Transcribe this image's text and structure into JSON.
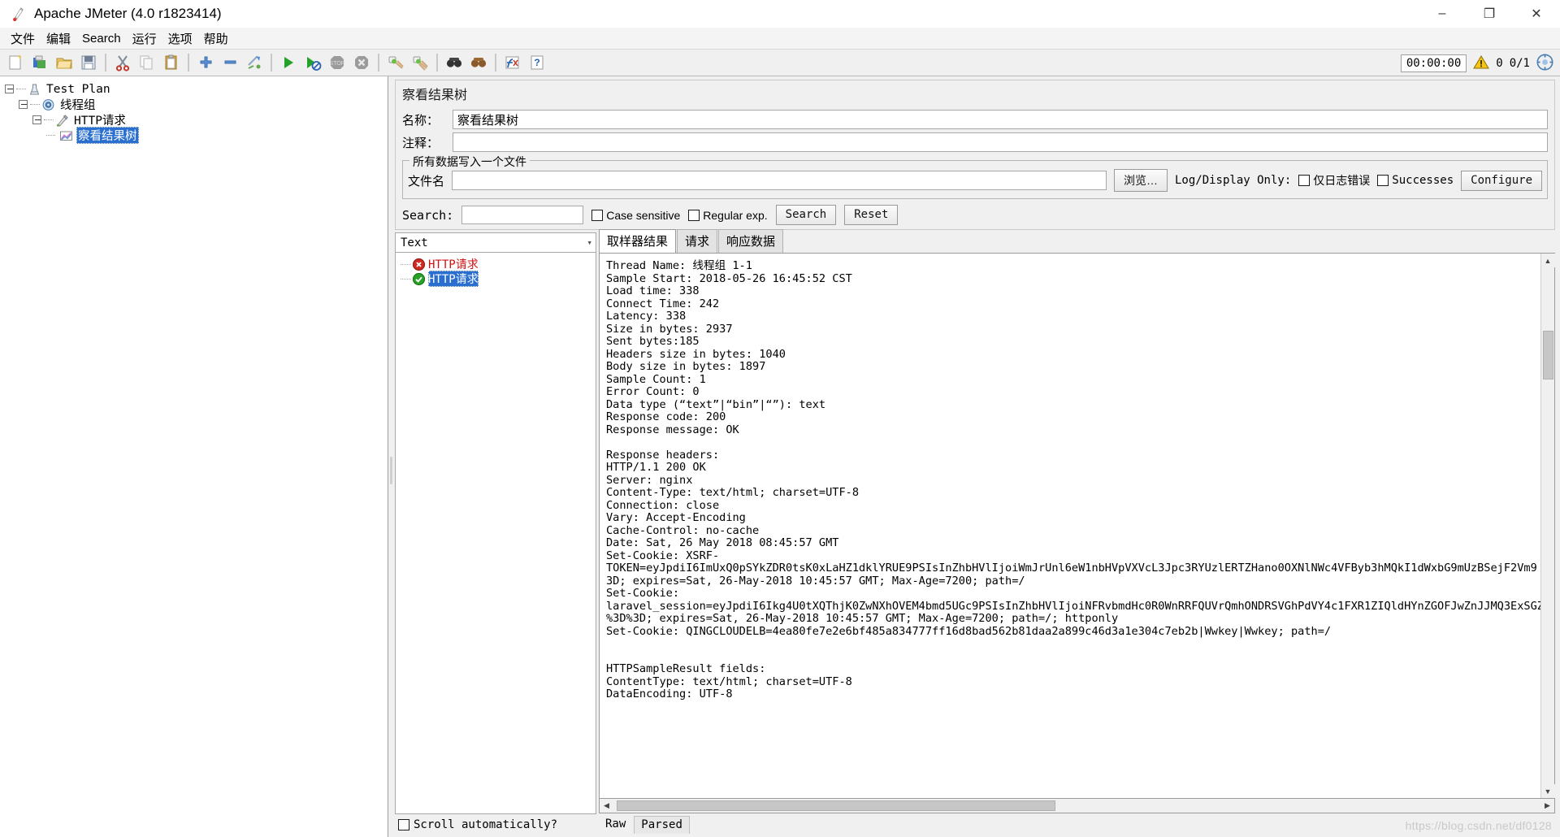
{
  "window": {
    "title": "Apache JMeter (4.0 r1823414)",
    "app_icon": "jmeter-feather-icon",
    "minimize": "–",
    "maximize": "❐",
    "close": "✕"
  },
  "menu": {
    "items": [
      {
        "name": "menu-file",
        "label": "文件"
      },
      {
        "name": "menu-edit",
        "label": "编辑"
      },
      {
        "name": "menu-search",
        "label": "Search"
      },
      {
        "name": "menu-run",
        "label": "运行"
      },
      {
        "name": "menu-options",
        "label": "选项"
      },
      {
        "name": "menu-help",
        "label": "帮助"
      }
    ]
  },
  "toolbar": {
    "buttons": [
      {
        "name": "new-button",
        "icon": "new-document-icon"
      },
      {
        "name": "templates-button",
        "icon": "templates-icon"
      },
      {
        "name": "open-button",
        "icon": "open-folder-icon"
      },
      {
        "name": "save-button",
        "icon": "save-floppy-icon"
      },
      {
        "name": "cut-button",
        "icon": "cut-scissors-icon"
      },
      {
        "name": "copy-button",
        "icon": "copy-icon"
      },
      {
        "name": "paste-button",
        "icon": "paste-clipboard-icon"
      },
      {
        "name": "expand-button",
        "icon": "plus-icon"
      },
      {
        "name": "collapse-button",
        "icon": "minus-icon"
      },
      {
        "name": "toggle-button",
        "icon": "toggle-icon"
      },
      {
        "name": "start-button",
        "icon": "play-green-icon"
      },
      {
        "name": "start-no-pauses-button",
        "icon": "play-no-pause-icon"
      },
      {
        "name": "stop-button",
        "icon": "stop-sign-icon"
      },
      {
        "name": "shutdown-button",
        "icon": "shutdown-x-icon"
      },
      {
        "name": "clear-button",
        "icon": "clear-broom-icon"
      },
      {
        "name": "clear-all-button",
        "icon": "clear-all-broom-icon"
      },
      {
        "name": "search-button",
        "icon": "binoculars-icon"
      },
      {
        "name": "reset-search-button",
        "icon": "reset-search-icon"
      },
      {
        "name": "function-helper-button",
        "icon": "function-helper-icon"
      },
      {
        "name": "help-button",
        "icon": "question-help-icon"
      }
    ],
    "timer": "00:00:00",
    "warning_icon": "warning-triangle-icon",
    "warning_count": "0",
    "threads_count": "0/1",
    "status_icon": "active-threads-icon"
  },
  "tree": {
    "nodes": [
      {
        "name": "tree-node-test-plan",
        "label": "Test Plan",
        "icon": "test-plan-icon",
        "depth": 0,
        "expanded": true,
        "selected": false
      },
      {
        "name": "tree-node-thread-group",
        "label": "线程组",
        "icon": "thread-group-icon",
        "depth": 1,
        "expanded": true,
        "selected": false
      },
      {
        "name": "tree-node-http-request",
        "label": "HTTP请求",
        "icon": "http-request-icon",
        "depth": 2,
        "expanded": true,
        "selected": false
      },
      {
        "name": "tree-node-view-results-tree",
        "label": "察看结果树",
        "icon": "view-results-tree-icon",
        "depth": 3,
        "expanded": false,
        "selected": true
      }
    ]
  },
  "panel": {
    "title": "察看结果树",
    "name_label": "名称：",
    "name_value": "察看结果树",
    "comment_label": "注释：",
    "comment_value": "",
    "filegroup": {
      "legend": "所有数据写入一个文件",
      "filename_label": "文件名",
      "filename_value": "",
      "browse_label": "浏览…",
      "logdisplay_label": "Log/Display Only:",
      "errors_only_label": "仅日志错误",
      "errors_only_checked": false,
      "successes_label": "Successes",
      "successes_checked": false,
      "configure_label": "Configure"
    },
    "search": {
      "label": "Search:",
      "value": "",
      "case_sensitive_label": "Case sensitive",
      "case_sensitive_checked": false,
      "regex_label": "Regular exp.",
      "regex_checked": false,
      "search_button": "Search",
      "reset_button": "Reset"
    }
  },
  "results": {
    "render_selected": "Text",
    "items": [
      {
        "name": "result-item-failed",
        "label": "HTTP请求",
        "status": "error",
        "selected": false
      },
      {
        "name": "result-item-success",
        "label": "HTTP请求",
        "status": "ok",
        "selected": true
      }
    ],
    "scroll_auto_label": "Scroll automatically?",
    "scroll_auto_checked": false
  },
  "detail": {
    "tabs": [
      {
        "name": "tab-sampler-result",
        "label": "取样器结果",
        "active": true
      },
      {
        "name": "tab-request",
        "label": "请求",
        "active": false
      },
      {
        "name": "tab-response-data",
        "label": "响应数据",
        "active": false
      }
    ],
    "bottom_tabs": [
      {
        "name": "bottom-tab-raw",
        "label": "Raw",
        "active": false
      },
      {
        "name": "bottom-tab-parsed",
        "label": "Parsed",
        "active": true
      }
    ],
    "content": "Thread Name: 线程组 1-1\nSample Start: 2018-05-26 16:45:52 CST\nLoad time: 338\nConnect Time: 242\nLatency: 338\nSize in bytes: 2937\nSent bytes:185\nHeaders size in bytes: 1040\nBody size in bytes: 1897\nSample Count: 1\nError Count: 0\nData type (“text”|“bin”|“”): text\nResponse code: 200\nResponse message: OK\n\nResponse headers:\nHTTP/1.1 200 OK\nServer: nginx\nContent-Type: text/html; charset=UTF-8\nConnection: close\nVary: Accept-Encoding\nCache-Control: no-cache\nDate: Sat, 26 May 2018 08:45:57 GMT\nSet-Cookie: XSRF-\nTOKEN=eyJpdiI6ImUxQ0pSYkZDR0tsK0xLaHZ1dklYRUE9PSIsInZhbHVlIjoiWmJrUnl6eW1nbHVpVXVcL3Jpc3RYUzlERTZHano0OXNlNWc4VFByb3hMQkI1dWxbG9mUzBSejF2Vm9\n3D; expires=Sat, 26-May-2018 10:45:57 GMT; Max-Age=7200; path=/\nSet-Cookie:\nlaravel_session=eyJpdiI6Ikg4U0tXQThjK0ZwNXhOVEM4bmd5UGc9PSIsInZhbHVlIjoiNFRvbmdHc0R0WnRRFQUVrQmhONDRSVGhPdVY4c1FXR1ZIQldHYnZGOFJwZnJJMQ3ExSGZKW\n%3D%3D; expires=Sat, 26-May-2018 10:45:57 GMT; Max-Age=7200; path=/; httponly\nSet-Cookie: QINGCLOUDELB=4ea80fe7e2e6bf485a834777ff16d8bad562b81daa2a899c46d3a1e304c7eb2b|Wwkey|Wwkey; path=/\n\n\nHTTPSampleResult fields:\nContentType: text/html; charset=UTF-8\nDataEncoding: UTF-8"
  },
  "watermark": "https://blog.csdn.net/df0128"
}
